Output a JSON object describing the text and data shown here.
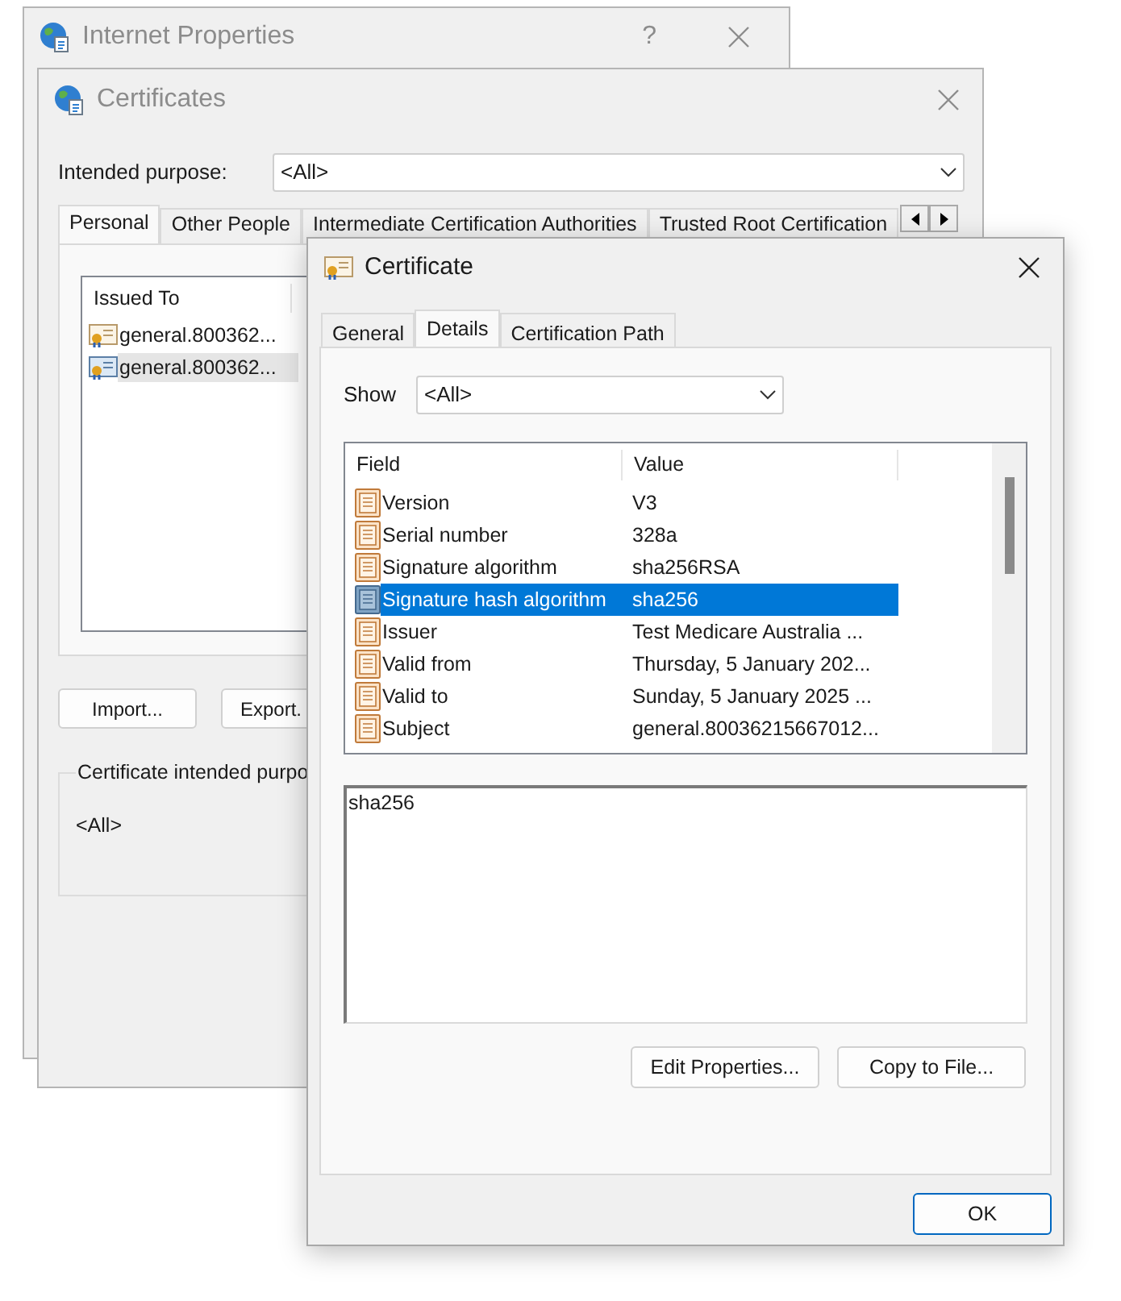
{
  "internet_properties": {
    "title": "Internet Properties",
    "help": "?"
  },
  "certificates": {
    "title": "Certificates",
    "purpose_label": "Intended purpose:",
    "purpose_value": "<All>",
    "tabs": [
      {
        "label": "Personal",
        "selected": true
      },
      {
        "label": "Other People",
        "selected": false
      },
      {
        "label": "Intermediate Certification Authorities",
        "selected": false
      },
      {
        "label": "Trusted Root Certification",
        "selected": false
      }
    ],
    "list": {
      "columns": [
        "Issued To"
      ],
      "rows": [
        {
          "issued_to": "general.800362...",
          "selected": false
        },
        {
          "issued_to": "general.800362...",
          "selected": true
        }
      ]
    },
    "buttons": [
      "Import...",
      "Export."
    ],
    "group": {
      "legend": "Certificate intended purpo",
      "value": "<All>"
    }
  },
  "certificate": {
    "title": "Certificate",
    "tabs": [
      {
        "label": "General",
        "selected": false
      },
      {
        "label": "Details",
        "selected": true
      },
      {
        "label": "Certification Path",
        "selected": false
      }
    ],
    "show_label": "Show",
    "show_value": "<All>",
    "columns": [
      "Field",
      "Value"
    ],
    "rows": [
      {
        "field": "Version",
        "value": "V3",
        "selected": false
      },
      {
        "field": "Serial number",
        "value": "328a",
        "selected": false
      },
      {
        "field": "Signature algorithm",
        "value": "sha256RSA",
        "selected": false
      },
      {
        "field": "Signature hash algorithm",
        "value": "sha256",
        "selected": true
      },
      {
        "field": "Issuer",
        "value": "Test Medicare Australia ...",
        "selected": false
      },
      {
        "field": "Valid from",
        "value": "Thursday, 5 January 202...",
        "selected": false
      },
      {
        "field": "Valid to",
        "value": "Sunday, 5 January 2025 ...",
        "selected": false
      },
      {
        "field": "Subject",
        "value": "general.80036215667012...",
        "selected": false
      }
    ],
    "detail_text": "sha256",
    "buttons": [
      "Edit Properties...",
      "Copy to File..."
    ],
    "ok": "OK"
  }
}
